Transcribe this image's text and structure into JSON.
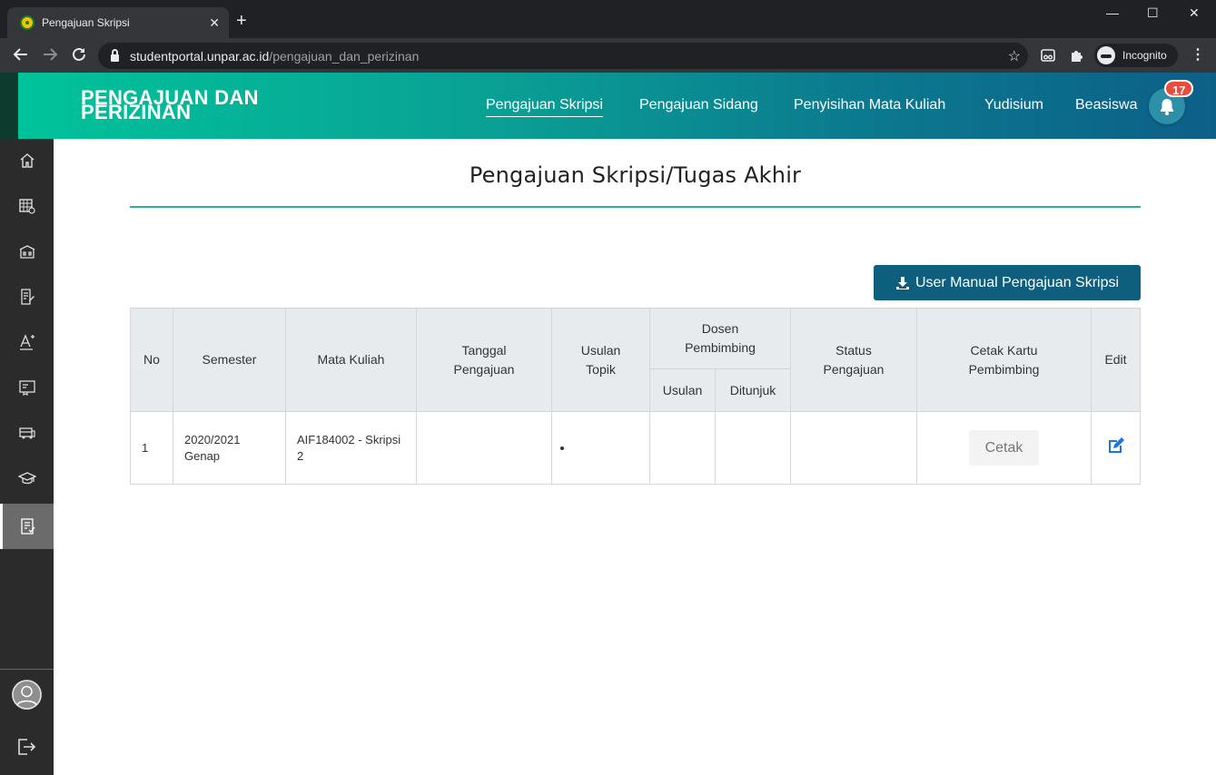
{
  "browser": {
    "tab_title": "Pengajuan Skripsi",
    "tab_close": "✕",
    "new_tab": "+",
    "url_host": "studentportal.unpar.ac.id",
    "url_path": "/pengajuan_dan_perizinan",
    "profile_label": "Incognito",
    "window_minimize": "—",
    "window_maximize": "☐",
    "window_close": "✕"
  },
  "header": {
    "brand_line1": "PENGAJUAN DAN",
    "brand_line2": "PERIZINAN",
    "nav": [
      {
        "label": "Pengajuan Skripsi"
      },
      {
        "label": "Pengajuan Sidang"
      },
      {
        "label": "Penyisihan Mata Kuliah"
      },
      {
        "label": "Yudisium"
      },
      {
        "label": "Beasiswa"
      }
    ],
    "notification_count": "17"
  },
  "page": {
    "title": "Pengajuan Skripsi/Tugas Akhir",
    "manual_button": "User Manual Pengajuan Skripsi"
  },
  "table": {
    "headers": {
      "no": "No",
      "semester": "Semester",
      "mata_kuliah": "Mata Kuliah",
      "tanggal_1": "Tanggal",
      "tanggal_2": "Pengajuan",
      "usulan_1": "Usulan",
      "usulan_2": "Topik",
      "dosen_1": "Dosen",
      "dosen_2": "Pembimbing",
      "dosen_usulan": "Usulan",
      "dosen_ditunjuk": "Ditunjuk",
      "status_1": "Status",
      "status_2": "Pengajuan",
      "cetak_1": "Cetak Kartu",
      "cetak_2": "Pembimbing",
      "edit": "Edit"
    },
    "rows": [
      {
        "no": "1",
        "semester_1": "2020/2021",
        "semester_2": "Genap",
        "mk_1": "AIF184002 - Skripsi",
        "mk_2": "2",
        "tanggal": "",
        "usulan_topik": "",
        "dosen_usulan": "",
        "dosen_ditunjuk": "",
        "status": "",
        "cetak_label": "Cetak"
      }
    ]
  },
  "colors": {
    "header_start": "#00c39a",
    "header_end": "#0d5f88",
    "accent_rule": "#2bb39a",
    "manual_button": "#0d5f7d",
    "edit_icon": "#1a73e8",
    "badge": "#e74c3c"
  },
  "icons": {
    "sidebar": [
      "home-icon",
      "schedule-icon",
      "building-icon",
      "document-edit-icon",
      "grade-icon",
      "certificate-icon",
      "bus-icon",
      "graduation-cap-icon",
      "checklist-icon"
    ],
    "bottom": [
      "user-avatar-icon",
      "logout-icon"
    ]
  }
}
